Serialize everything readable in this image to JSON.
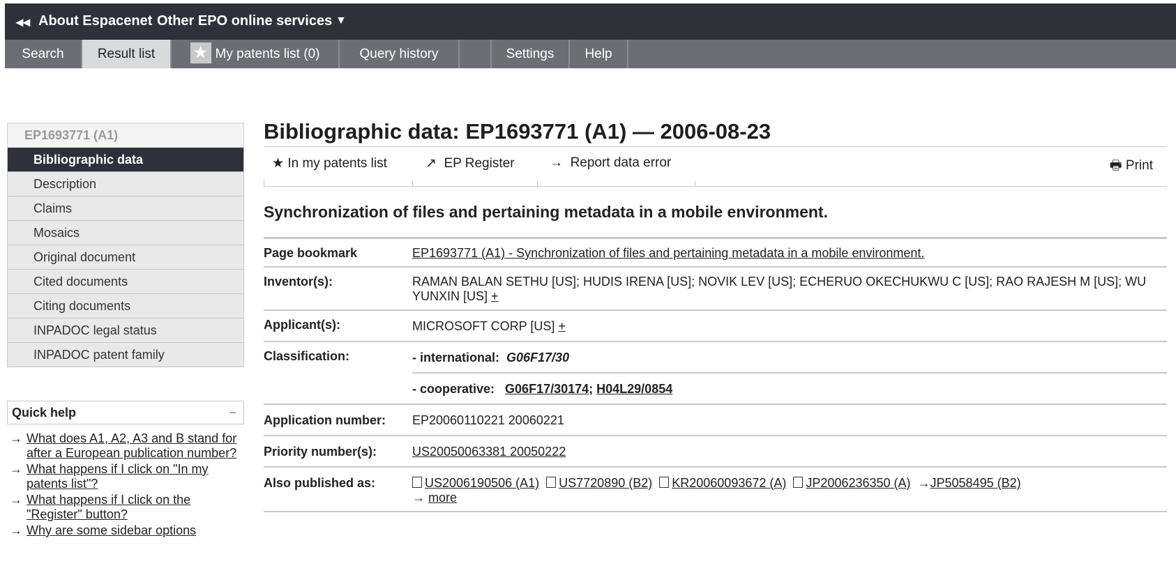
{
  "topbar": {
    "back_icon": "double-left-arrow-icon",
    "about": "About Espacenet",
    "other_services": "Other EPO online services",
    "caret": "▼"
  },
  "nav": {
    "tabs": [
      "Search",
      "Result list",
      "My patents list (0)",
      "Query history",
      "",
      "Settings",
      "Help"
    ],
    "star_icon": "star-icon"
  },
  "sidebar": {
    "header": "EP1693771  (A1)",
    "items": [
      "Bibliographic data",
      "Description",
      "Claims",
      "Mosaics",
      "Original document",
      "Cited documents",
      "Citing documents",
      "INPADOC legal status",
      "INPADOC patent family"
    ]
  },
  "quick_help": {
    "title": "Quick help",
    "toggle": "−",
    "links": [
      "What does A1, A2, A3 and B stand for after a European publication number?",
      "What happens if I click on \"In my patents list\"?",
      "What happens if I click on the \"Register\" button?",
      "Why are some sidebar options"
    ]
  },
  "main": {
    "heading": "Bibliographic data: EP1693771  (A1) — 2006-08-23",
    "actions": {
      "my_patents": "In my patents list",
      "ep_register": "EP Register",
      "report_error": "Report data error",
      "print": "Print"
    },
    "title": "Synchronization of files and pertaining metadata in a mobile environment.",
    "rows": {
      "bookmark_label": "Page bookmark",
      "bookmark_value": "EP1693771  (A1)  -  Synchronization of files and pertaining metadata in a mobile environment.",
      "inventors_label": "Inventor(s):",
      "inventors_value": "RAMAN BALAN SETHU [US]; HUDIS IRENA [US]; NOVIK LEV [US]; ECHERUO OKECHUKWU C [US]; RAO RAJESH M [US]; WU YUNXIN [US]",
      "plus": "+",
      "applicants_label": "Applicant(s):",
      "applicants_value": "MICROSOFT CORP [US]",
      "classification_label": "Classification:",
      "intl_label": "- international:",
      "intl_value": "G06F17/30",
      "coop_label": "- cooperative:",
      "coop_values": [
        "G06F17/30174",
        "H04L29/0854"
      ],
      "app_number_label": "Application number:",
      "app_number_value": "EP20060110221 20060221",
      "priority_label": "Priority number(s):",
      "priority_value": "US20050063381 20050222",
      "also_label": "Also published as:",
      "also_values": [
        "US2006190506 (A1)",
        "US7720890 (B2)",
        "KR20060093672 (A)",
        "JP2006236350 (A)",
        "JP5058495 (B2)"
      ],
      "more": "more"
    }
  }
}
